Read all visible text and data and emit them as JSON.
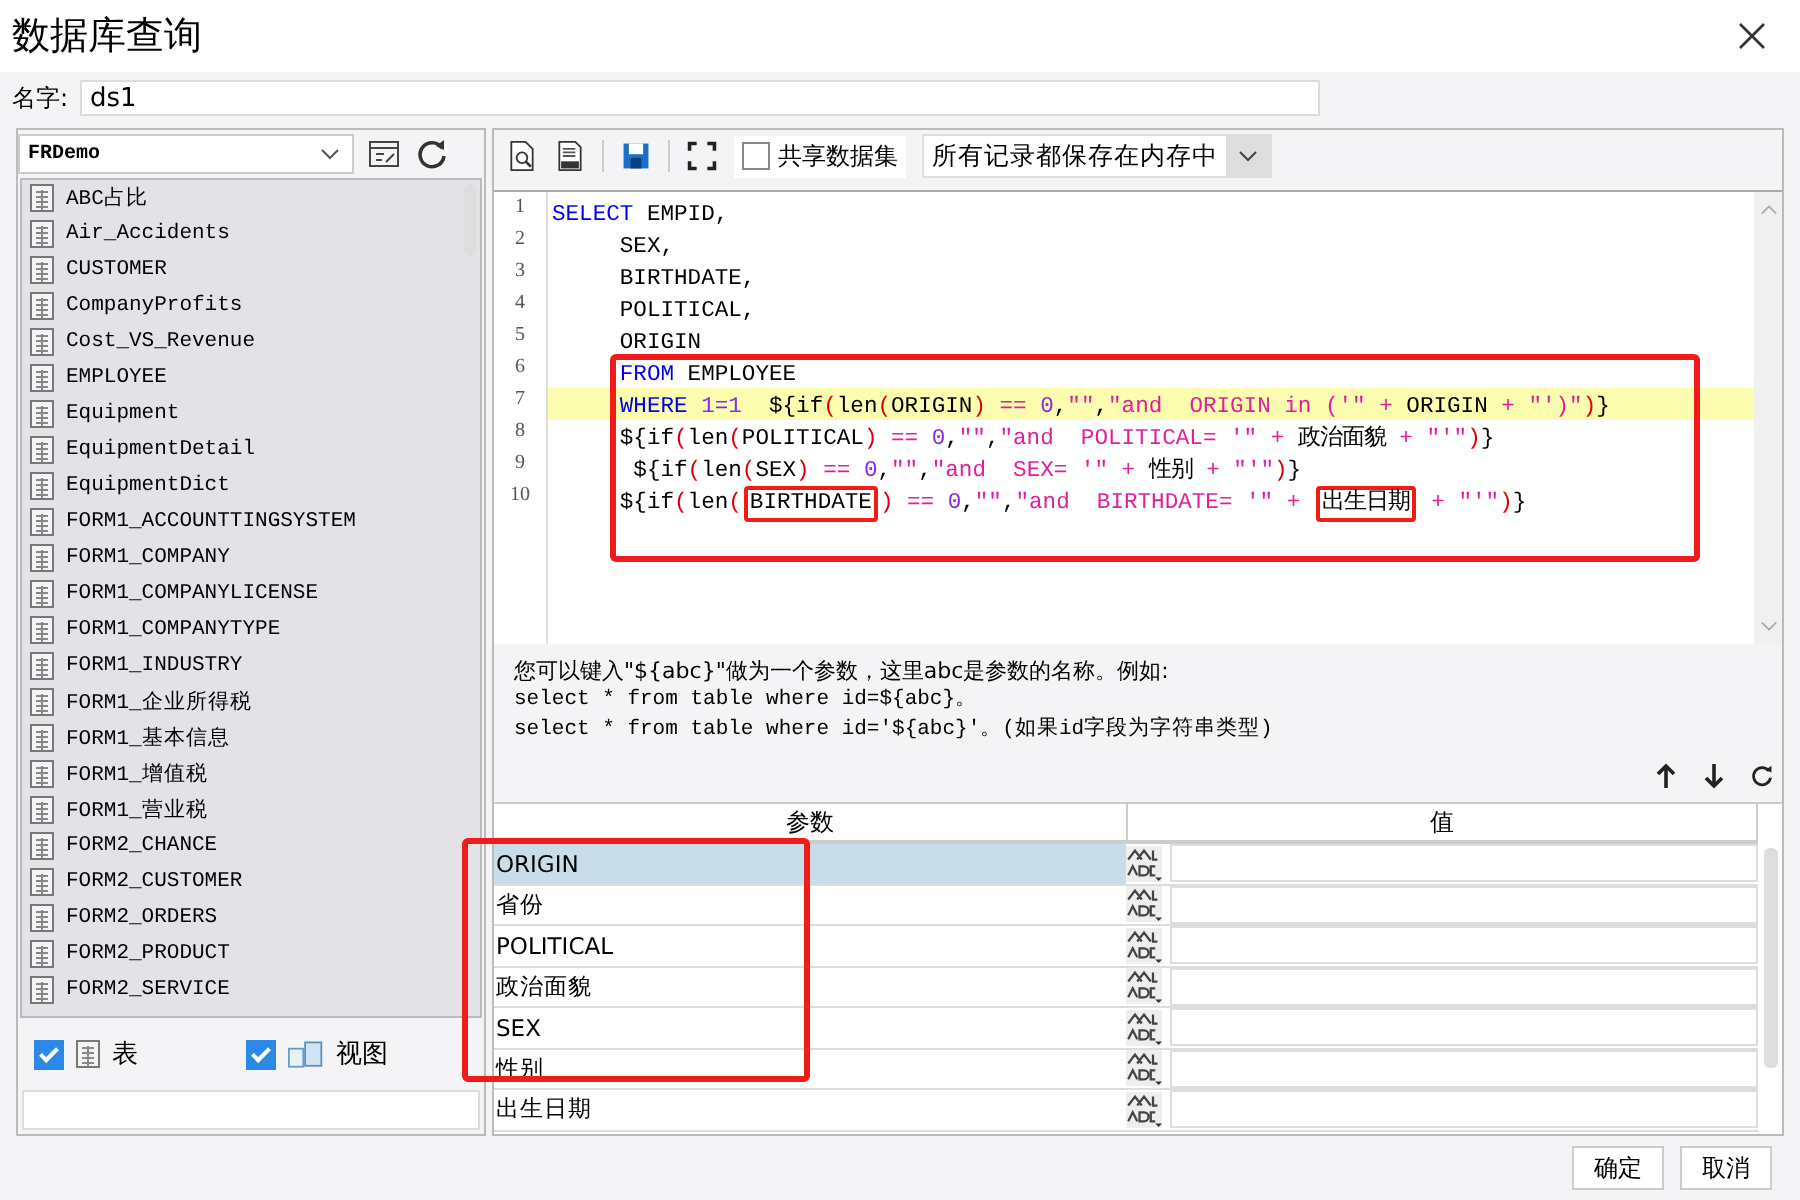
{
  "window": {
    "title": "数据库查询"
  },
  "name_field": {
    "label": "名字:",
    "value": "ds1"
  },
  "sidebar": {
    "connection": "FRDemo",
    "items": [
      {
        "label": "ABC占比",
        "kind": "table"
      },
      {
        "label": "Air_Accidents",
        "kind": "table"
      },
      {
        "label": "CUSTOMER",
        "kind": "table"
      },
      {
        "label": "CompanyProfits",
        "kind": "table"
      },
      {
        "label": "Cost_VS_Revenue",
        "kind": "table"
      },
      {
        "label": "EMPLOYEE",
        "kind": "table"
      },
      {
        "label": "Equipment",
        "kind": "table"
      },
      {
        "label": "EquipmentDetail",
        "kind": "table"
      },
      {
        "label": "EquipmentDict",
        "kind": "table"
      },
      {
        "label": "FORM1_ACCOUNTTINGSYSTEM",
        "kind": "table"
      },
      {
        "label": "FORM1_COMPANY",
        "kind": "table"
      },
      {
        "label": "FORM1_COMPANYLICENSE",
        "kind": "table"
      },
      {
        "label": "FORM1_COMPANYTYPE",
        "kind": "table"
      },
      {
        "label": "FORM1_INDUSTRY",
        "kind": "table"
      },
      {
        "label": "FORM1_企业所得税",
        "kind": "table"
      },
      {
        "label": "FORM1_基本信息",
        "kind": "table"
      },
      {
        "label": "FORM1_增值税",
        "kind": "table"
      },
      {
        "label": "FORM1_营业税",
        "kind": "table"
      },
      {
        "label": "FORM2_CHANCE",
        "kind": "table"
      },
      {
        "label": "FORM2_CUSTOMER",
        "kind": "table"
      },
      {
        "label": "FORM2_ORDERS",
        "kind": "table"
      },
      {
        "label": "FORM2_PRODUCT",
        "kind": "table"
      },
      {
        "label": "FORM2_SERVICE",
        "kind": "table"
      }
    ],
    "filters": [
      {
        "label": "表",
        "kind": "table",
        "checked": true
      },
      {
        "label": "视图",
        "kind": "view",
        "checked": true
      }
    ]
  },
  "toolbar": {
    "share": {
      "label": "共享数据集",
      "checked": false
    },
    "storage": "所有记录都保存在内存中"
  },
  "code": [
    {
      "highlighted": false,
      "tokens": [
        {
          "kind": "keyword",
          "text": "SELECT",
          "boxed": false
        },
        {
          "kind": "plain",
          "text": " EMPID,",
          "boxed": false
        }
      ]
    },
    {
      "highlighted": false,
      "tokens": [
        {
          "kind": "plain",
          "text": "     SEX,",
          "boxed": false
        }
      ]
    },
    {
      "highlighted": false,
      "tokens": [
        {
          "kind": "plain",
          "text": "     BIRTHDATE,",
          "boxed": false
        }
      ]
    },
    {
      "highlighted": false,
      "tokens": [
        {
          "kind": "plain",
          "text": "     POLITICAL,",
          "boxed": false
        }
      ]
    },
    {
      "highlighted": false,
      "tokens": [
        {
          "kind": "plain",
          "text": "     ORIGIN",
          "boxed": false
        }
      ]
    },
    {
      "highlighted": false,
      "tokens": [
        {
          "kind": "keyword",
          "text": "     FROM",
          "boxed": false
        },
        {
          "kind": "plain",
          "text": " EMPLOYEE",
          "boxed": false
        }
      ]
    },
    {
      "highlighted": true,
      "tokens": [
        {
          "kind": "keyword",
          "text": "     WHERE ",
          "boxed": false
        },
        {
          "kind": "number",
          "text": "1=1",
          "boxed": false
        },
        {
          "kind": "plain",
          "text": "  ${if",
          "boxed": false
        },
        {
          "kind": "operator",
          "text": "(",
          "boxed": false
        },
        {
          "kind": "plain",
          "text": "len",
          "boxed": false
        },
        {
          "kind": "operator",
          "text": "(",
          "boxed": false
        },
        {
          "kind": "plain",
          "text": "ORIGIN",
          "boxed": false
        },
        {
          "kind": "operator",
          "text": ")",
          "boxed": false
        },
        {
          "kind": "string",
          "text": " == ",
          "boxed": false
        },
        {
          "kind": "number",
          "text": "0",
          "boxed": false
        },
        {
          "kind": "plain",
          "text": ",",
          "boxed": false
        },
        {
          "kind": "string",
          "text": "\"\"",
          "boxed": false
        },
        {
          "kind": "plain",
          "text": ",",
          "boxed": false
        },
        {
          "kind": "string",
          "text": "\"and  ORIGIN in ('\" + ",
          "boxed": false
        },
        {
          "kind": "plain",
          "text": "ORIGIN",
          "boxed": false
        },
        {
          "kind": "string",
          "text": " + \"')\"",
          "boxed": false
        },
        {
          "kind": "operator",
          "text": ")",
          "boxed": false
        },
        {
          "kind": "plain",
          "text": "}",
          "boxed": false
        }
      ]
    },
    {
      "highlighted": false,
      "tokens": [
        {
          "kind": "plain",
          "text": "     ${if",
          "boxed": false
        },
        {
          "kind": "operator",
          "text": "(",
          "boxed": false
        },
        {
          "kind": "plain",
          "text": "len",
          "boxed": false
        },
        {
          "kind": "operator",
          "text": "(",
          "boxed": false
        },
        {
          "kind": "plain",
          "text": "POLITICAL",
          "boxed": false
        },
        {
          "kind": "operator",
          "text": ")",
          "boxed": false
        },
        {
          "kind": "string",
          "text": " == ",
          "boxed": false
        },
        {
          "kind": "number",
          "text": "0",
          "boxed": false
        },
        {
          "kind": "plain",
          "text": ",",
          "boxed": false
        },
        {
          "kind": "string",
          "text": "\"\"",
          "boxed": false
        },
        {
          "kind": "plain",
          "text": ",",
          "boxed": false
        },
        {
          "kind": "string",
          "text": "\"and  POLITICAL= '\" + ",
          "boxed": false
        },
        {
          "kind": "plain",
          "text": "政治面貌",
          "boxed": false
        },
        {
          "kind": "string",
          "text": " + \"'\"",
          "boxed": false
        },
        {
          "kind": "operator",
          "text": ")",
          "boxed": false
        },
        {
          "kind": "plain",
          "text": "}",
          "boxed": false
        }
      ]
    },
    {
      "highlighted": false,
      "tokens": [
        {
          "kind": "plain",
          "text": "      ${if",
          "boxed": false
        },
        {
          "kind": "operator",
          "text": "(",
          "boxed": false
        },
        {
          "kind": "plain",
          "text": "len",
          "boxed": false
        },
        {
          "kind": "operator",
          "text": "(",
          "boxed": false
        },
        {
          "kind": "plain",
          "text": "SEX",
          "boxed": false
        },
        {
          "kind": "operator",
          "text": ")",
          "boxed": false
        },
        {
          "kind": "string",
          "text": " == ",
          "boxed": false
        },
        {
          "kind": "number",
          "text": "0",
          "boxed": false
        },
        {
          "kind": "plain",
          "text": ",",
          "boxed": false
        },
        {
          "kind": "string",
          "text": "\"\"",
          "boxed": false
        },
        {
          "kind": "plain",
          "text": ",",
          "boxed": false
        },
        {
          "kind": "string",
          "text": "\"and  SEX= '\" + ",
          "boxed": false
        },
        {
          "kind": "plain",
          "text": "性别",
          "boxed": false
        },
        {
          "kind": "string",
          "text": " + \"'\"",
          "boxed": false
        },
        {
          "kind": "operator",
          "text": ")",
          "boxed": false
        },
        {
          "kind": "plain",
          "text": "}",
          "boxed": false
        }
      ]
    },
    {
      "highlighted": false,
      "tokens": [
        {
          "kind": "plain",
          "text": "     ${if",
          "boxed": false
        },
        {
          "kind": "operator",
          "text": "(",
          "boxed": false
        },
        {
          "kind": "plain",
          "text": "len",
          "boxed": false
        },
        {
          "kind": "operator",
          "text": "(",
          "boxed": false
        },
        {
          "kind": "plain",
          "text": "BIRTHDATE",
          "boxed": true
        },
        {
          "kind": "operator",
          "text": ")",
          "boxed": false
        },
        {
          "kind": "string",
          "text": " == ",
          "boxed": false
        },
        {
          "kind": "number",
          "text": "0",
          "boxed": false
        },
        {
          "kind": "plain",
          "text": ",",
          "boxed": false
        },
        {
          "kind": "string",
          "text": "\"\"",
          "boxed": false
        },
        {
          "kind": "plain",
          "text": ",",
          "boxed": false
        },
        {
          "kind": "string",
          "text": "\"and  BIRTHDATE= '\" + ",
          "boxed": false
        },
        {
          "kind": "plain",
          "text": "出生日期",
          "boxed": true
        },
        {
          "kind": "string",
          "text": " + \"'\"",
          "boxed": false
        },
        {
          "kind": "operator",
          "text": ")",
          "boxed": false
        },
        {
          "kind": "plain",
          "text": "}",
          "boxed": false
        }
      ]
    }
  ],
  "line_numbers": [
    "1",
    "2",
    "3",
    "4",
    "5",
    "6",
    "7",
    "8",
    "9",
    "10"
  ],
  "help": [
    "您可以键入\"${abc}\"做为一个参数，这里abc是参数的名称。例如:",
    "select * from table where id=${abc}。",
    "select * from table where id='${abc}'。(如果id字段为字符串类型)"
  ],
  "params": {
    "columns": [
      "参数",
      "值"
    ],
    "rows": [
      {
        "name": "ORIGIN",
        "selected": true
      },
      {
        "name": "省份",
        "selected": false
      },
      {
        "name": "POLITICAL",
        "selected": false
      },
      {
        "name": "政治面貌",
        "selected": false
      },
      {
        "name": "SEX",
        "selected": false
      },
      {
        "name": "性别",
        "selected": false
      },
      {
        "name": "出生日期",
        "selected": false
      }
    ]
  },
  "buttons": [
    "确定",
    "取消"
  ]
}
